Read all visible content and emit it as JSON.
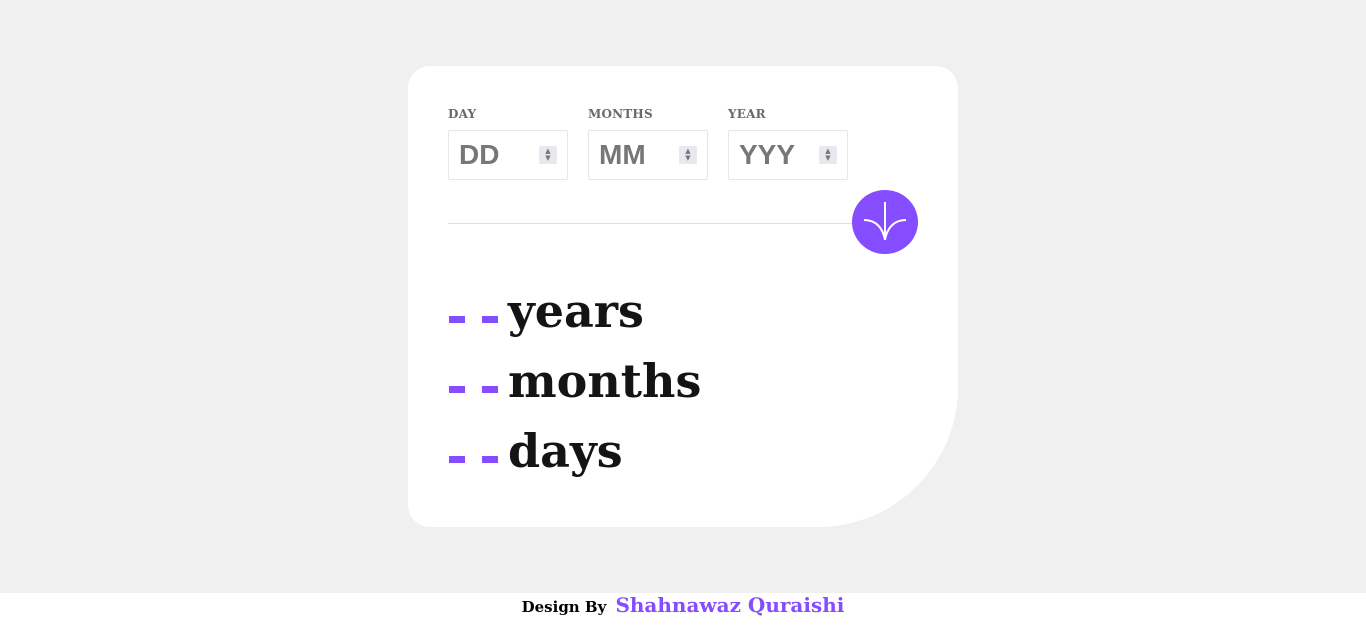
{
  "form": {
    "day": {
      "label": "DAY",
      "placeholder": "DD",
      "value": ""
    },
    "month": {
      "label": "MONTHS",
      "placeholder": "MM",
      "value": ""
    },
    "year": {
      "label": "YEAR",
      "placeholder": "YYY",
      "value": ""
    }
  },
  "submit": {
    "icon": "arrow-down-icon"
  },
  "results": {
    "years": {
      "value": "- -",
      "unit": "years"
    },
    "months": {
      "value": "- -",
      "unit": "months"
    },
    "days": {
      "value": "- -",
      "unit": "days"
    }
  },
  "footer": {
    "prefix": "Design By",
    "author": "Shahnawaz Quraishi"
  },
  "colors": {
    "accent": "#854dff",
    "background": "#f0f0f0",
    "card": "#ffffff",
    "text": "#141414",
    "label": "#6a6a6a"
  }
}
